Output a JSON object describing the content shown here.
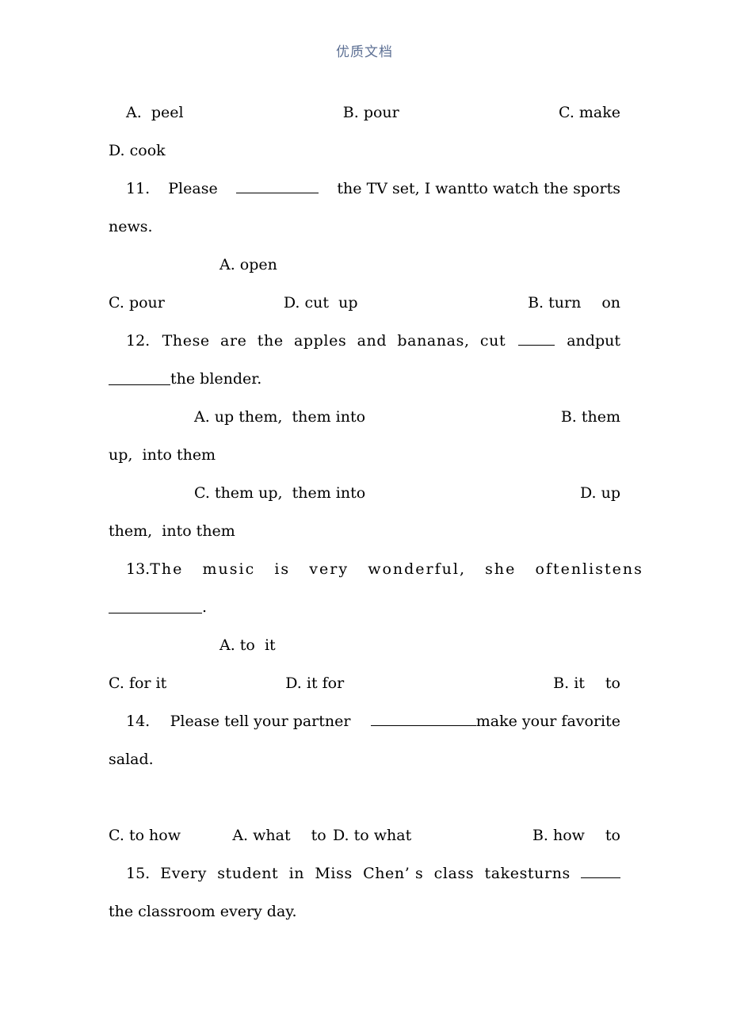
{
  "header": {
    "watermark": "优质文档"
  },
  "document": {
    "q10_options": {
      "a": "A.  peel",
      "b": "B. pour",
      "c": "C. make",
      "d": "D. cook"
    },
    "q11": {
      "number": "11.",
      "stem_before_blank": "Please",
      "stem_after_blank": "the TV set, I wantto watch the sports",
      "stem_line2": "news.",
      "options": {
        "a": "A. open",
        "b_word1": "B. turn",
        "b_word2": "on",
        "c": "C. pour",
        "d": "D. cut  up"
      }
    },
    "q12": {
      "number": "12.",
      "stem_line1_part1": "These  are  the  apples  and  bananas,  cut",
      "stem_line1_part2": "andput",
      "stem_line2": "the blender.",
      "options": {
        "a": "A. up them,  them into",
        "b_part1": "B. them",
        "b_part2": "up,  into them",
        "c": "C. them up,  them into",
        "d_part1": "D. up",
        "d_part2": "them,  into them"
      }
    },
    "q13": {
      "number": "13.",
      "stem_line1": "The   music   is   very   wonderful,   she   oftenlistens",
      "stem_line2_period": ".",
      "options": {
        "a": "A. to  it",
        "b_word1": "B. it",
        "b_word2": "to",
        "c": "C. for it",
        "d": "D. it for"
      }
    },
    "q14": {
      "number": "14.",
      "stem_before_blank": "Please tell your partner",
      "stem_after_blank": "make your favorite",
      "stem_line2": "salad.",
      "options": {
        "a_word1": "A. what",
        "a_word2": "to",
        "b_word1": "B. how",
        "b_word2": "to",
        "c": "C. to how",
        "d": "D. to what"
      }
    },
    "q15": {
      "number": "15.",
      "stem_line1": "Every  student  in  Miss  Chen’ s  class  takesturns",
      "stem_line2": "the classroom every day."
    }
  }
}
